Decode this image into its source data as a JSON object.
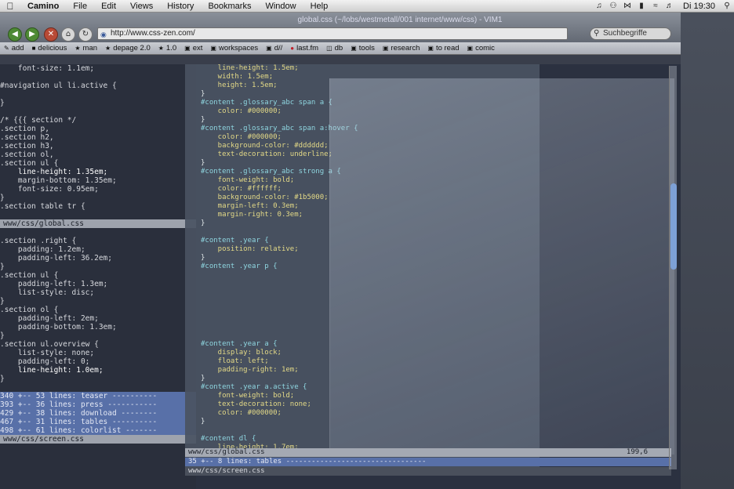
{
  "menubar": {
    "app_name": "Camino",
    "items": [
      "File",
      "Edit",
      "Views",
      "History",
      "Bookmarks",
      "Window",
      "Help"
    ],
    "clock": "Di 19:30"
  },
  "window_title": "global.css (~/lobs/westmetall/001 internet/www/css) - VIM1",
  "browser": {
    "url": "http://www.css-zen.com/",
    "search_placeholder": "Suchbegriffe"
  },
  "bookmarks": [
    {
      "label": "add",
      "icon": "pencil-icon"
    },
    {
      "label": "delicious",
      "icon": "delicious-icon"
    },
    {
      "label": "man",
      "icon": "star-icon"
    },
    {
      "label": "depage 2.0",
      "icon": "star-icon"
    },
    {
      "label": "1.0",
      "icon": "star-icon"
    },
    {
      "label": "ext",
      "icon": "folder-icon"
    },
    {
      "label": "workspaces",
      "icon": "folder-icon"
    },
    {
      "label": "d//",
      "icon": "folder-icon"
    },
    {
      "label": "last.fm",
      "icon": "lastfm-icon"
    },
    {
      "label": "db",
      "icon": "db-icon"
    },
    {
      "label": "tools",
      "icon": "folder-icon"
    },
    {
      "label": "research",
      "icon": "folder-icon"
    },
    {
      "label": "to read",
      "icon": "folder-icon"
    },
    {
      "label": "comic",
      "icon": "folder-icon"
    }
  ],
  "left_editor": {
    "lines": [
      {
        "num": "",
        "text": "    font-size: 1.1em;"
      },
      {
        "num": "",
        "text": ""
      },
      {
        "num": "",
        "text": "#navigation ul li.active {"
      },
      {
        "num": "",
        "text": ""
      },
      {
        "num": "",
        "text": "}"
      },
      {
        "num": "",
        "text": ""
      },
      {
        "num": "",
        "text": "/* {{{ section */"
      },
      {
        "num": "",
        "text": ".section p,"
      },
      {
        "num": "",
        "text": ".section h2,"
      },
      {
        "num": "",
        "text": ".section h3,"
      },
      {
        "num": "",
        "text": ".section ol,"
      },
      {
        "num": "",
        "text": ".section ul {"
      },
      {
        "num": "",
        "text": "    line-height: 1.35em;"
      },
      {
        "num": "",
        "text": "    margin-bottom: 1.35em;"
      },
      {
        "num": "",
        "text": "    font-size: 0.95em;"
      },
      {
        "num": "",
        "text": "}"
      },
      {
        "num": "",
        "text": ".section table tr {"
      },
      {
        "num": "",
        "text": ""
      },
      {
        "num": "",
        "text": ""
      },
      {
        "num": "",
        "text": ".section .right {"
      },
      {
        "num": "",
        "text": "    padding: 1.2em;"
      },
      {
        "num": "",
        "text": "    padding-left: 36.2em;"
      },
      {
        "num": "",
        "text": "}"
      },
      {
        "num": "",
        "text": ".section ul {"
      },
      {
        "num": "",
        "text": "    padding-left: 1.3em;"
      },
      {
        "num": "",
        "text": "    list-style: disc;"
      },
      {
        "num": "",
        "text": "}"
      },
      {
        "num": "",
        "text": ".section ol {"
      },
      {
        "num": "",
        "text": "    padding-left: 2em;"
      },
      {
        "num": "",
        "text": "    padding-bottom: 1.3em;"
      },
      {
        "num": "",
        "text": "}"
      },
      {
        "num": "",
        "text": ".section ul.overview {"
      },
      {
        "num": "",
        "text": "    list-style: none;"
      },
      {
        "num": "",
        "text": "    padding-left: 0;"
      },
      {
        "num": "",
        "text": "    line-height: 1.0em;"
      },
      {
        "num": "",
        "text": "}"
      },
      {
        "num": "",
        "text": ""
      },
      {
        "num": "",
        "text": "340 +-- 53 lines: teaser ----------"
      },
      {
        "num": "",
        "text": "393 +-- 36 lines: press -----------"
      },
      {
        "num": "",
        "text": "429 +-- 38 lines: download --------"
      },
      {
        "num": "",
        "text": "467 +-- 31 lines: tables ----------"
      },
      {
        "num": "",
        "text": "498 +-- 61 lines: colorlist -------"
      }
    ],
    "status_top": "www/css/global.css",
    "status_bottom": "www/css/screen.css"
  },
  "main_editor": {
    "lines": [
      "    line-height: 1.5em;",
      "    width: 1.5em;",
      "    height: 1.5em;",
      "}",
      "#content .glossary_abc span a {",
      "    color: #000000;",
      "}",
      "#content .glossary_abc span a:hover {",
      "    color: #000000;",
      "    background-color: #dddddd;",
      "    text-decoration: underline;",
      "}",
      "#content .glossary_abc strong a {",
      "    font-weight: bold;",
      "    color: #ffffff;",
      "    background-color: #1b5000;",
      "    margin-left: 0.3em;",
      "    margin-right: 0.3em;",
      "}",
      "",
      "#content .year {",
      "    position: relative;",
      "}",
      "#content .year p {",
      "",
      "",
      "",
      "",
      "",
      "",
      "",
      "",
      "#content .year a {",
      "    display: block;",
      "    float: left;",
      "    padding-right: 1em;",
      "}",
      "#content .year a.active {",
      "    font-weight: bold;",
      "    text-decoration: none;",
      "    color: #000000;",
      "}",
      "",
      "#content dl {",
      "    line-height: 1.7em;"
    ],
    "status_file": "www/css/global.css",
    "status_pos": "199,6",
    "fold_line": "35 +-- 8 lines: tables ---------------------------------",
    "file_line": "www/css/screen.css"
  }
}
